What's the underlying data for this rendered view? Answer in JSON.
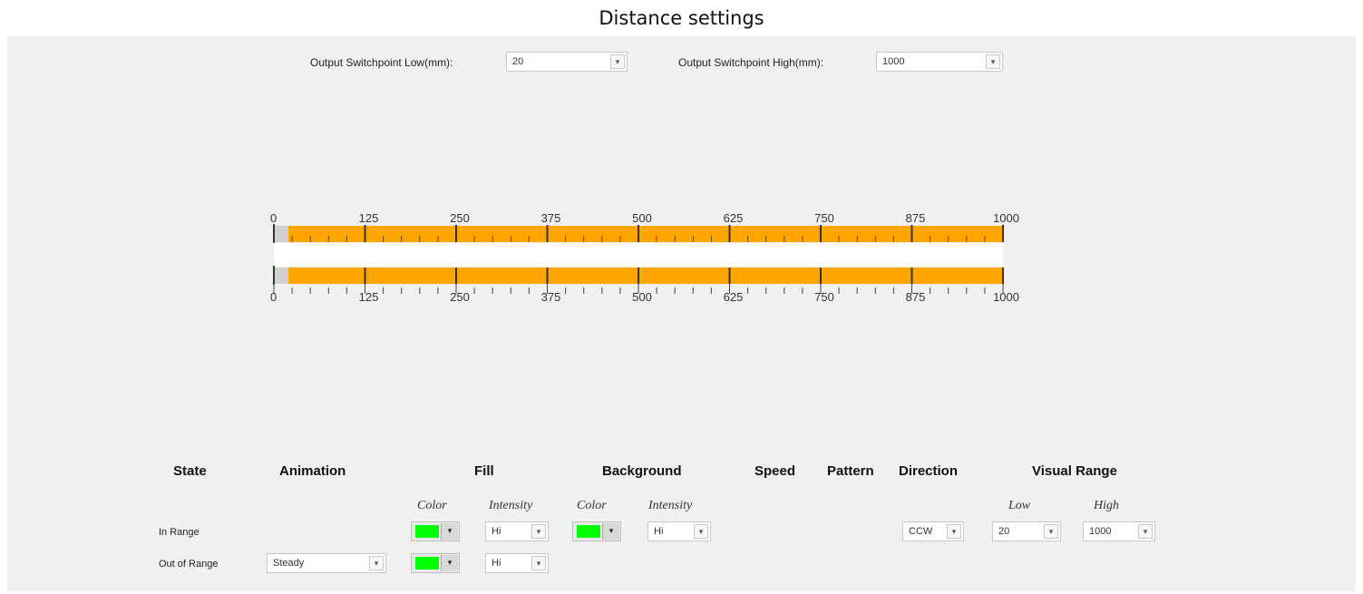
{
  "title": "Distance settings",
  "top_controls": {
    "low_label": "Output Switchpoint Low(mm):",
    "low_value": "20",
    "high_label": "Output Switchpoint High(mm):",
    "high_value": "1000"
  },
  "scale": {
    "min": 0,
    "max": 1000,
    "major_ticks": [
      0,
      125,
      250,
      375,
      500,
      625,
      750,
      875,
      1000
    ],
    "minor_step": 25,
    "range_low": 20,
    "range_high": 1000,
    "fill_color": "#ffa500",
    "out_color": "#d0d0d0"
  },
  "table": {
    "headers": {
      "state": "State",
      "animation": "Animation",
      "fill": "Fill",
      "background": "Background",
      "speed": "Speed",
      "pattern": "Pattern",
      "direction": "Direction",
      "visual_range": "Visual Range"
    },
    "subheaders": {
      "fill_color": "Color",
      "fill_intensity": "Intensity",
      "bg_color": "Color",
      "bg_intensity": "Intensity",
      "vr_low": "Low",
      "vr_high": "High"
    },
    "rows": [
      {
        "state": "In Range",
        "fill_color": "#00ff00",
        "fill_intensity": "Hi",
        "bg_color": "#00ff00",
        "bg_intensity": "Hi",
        "direction": "CCW",
        "vr_low": "20",
        "vr_high": "1000"
      },
      {
        "state": "Out of Range",
        "animation": "Steady",
        "fill_color": "#00ff00",
        "fill_intensity": "Hi"
      }
    ]
  },
  "icons": {
    "dropdown": "chevron-down-icon",
    "dropdown_glyph": "▾"
  }
}
